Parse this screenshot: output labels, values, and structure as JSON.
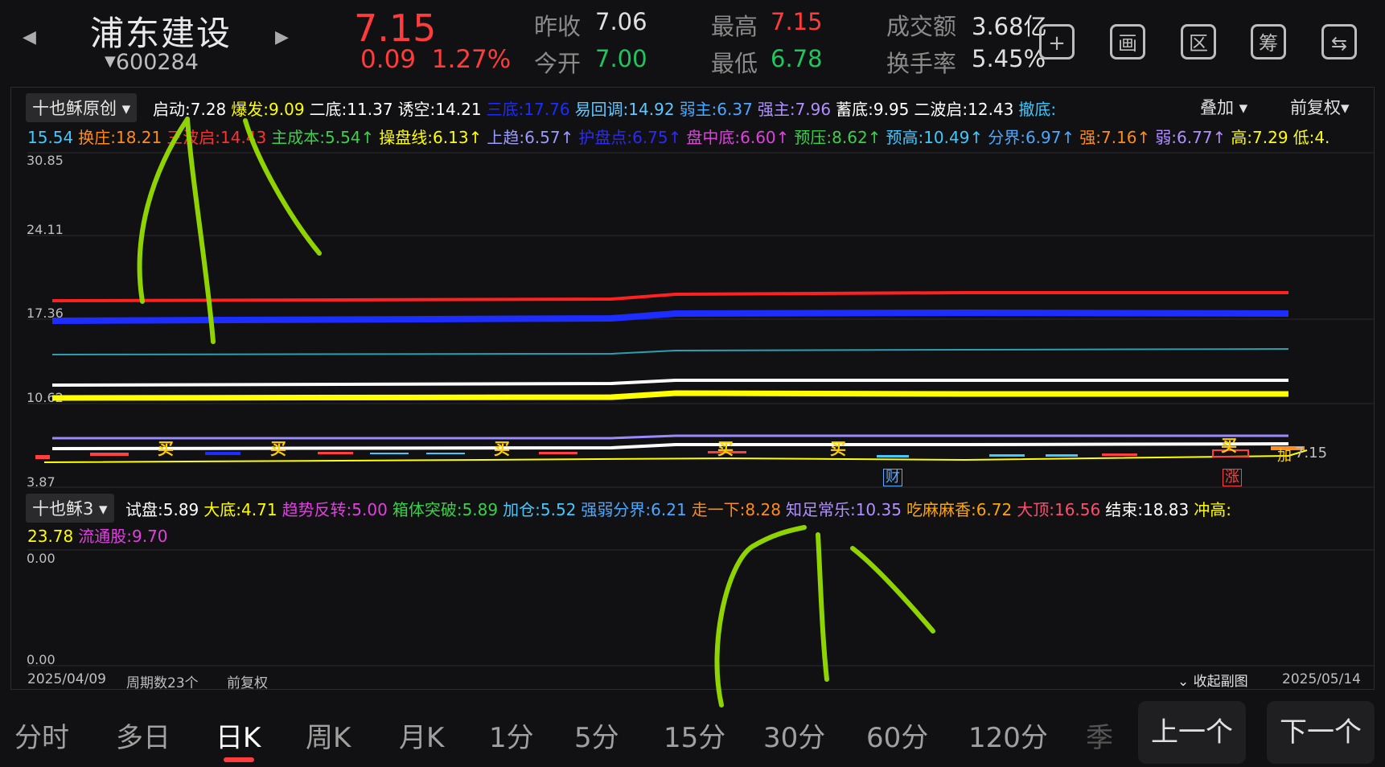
{
  "header": {
    "name": "浦东建设",
    "code": "600284",
    "price": "7.15",
    "change": "0.09",
    "change_pct": "1.27%",
    "prev_close_label": "昨收",
    "prev_close": "7.06",
    "open_label": "今开",
    "open": "7.00",
    "high_label": "最高",
    "high": "7.15",
    "low_label": "最低",
    "low": "6.78",
    "turnover_amt_label": "成交额",
    "turnover_amt": "3.68亿",
    "turnover_rate_label": "换手率",
    "turnover_rate": "5.45%"
  },
  "tools": [
    {
      "name": "add-icon",
      "glyph": "+"
    },
    {
      "name": "draw-icon",
      "glyph": "画"
    },
    {
      "name": "range-icon",
      "glyph": "区"
    },
    {
      "name": "chips-icon",
      "glyph": "筹"
    },
    {
      "name": "switch-device-icon",
      "glyph": "⇆"
    }
  ],
  "main_indicator": {
    "selector": "十也稣原创",
    "overlay": "叠加",
    "adjust": "前复权",
    "row1": [
      {
        "t": "启动:7.28",
        "c": "#ffffff"
      },
      {
        "t": "爆发:9.09",
        "c": "#ffff00"
      },
      {
        "t": "二底:11.37",
        "c": "#ffffff"
      },
      {
        "t": "诱空:14.21",
        "c": "#ffffff"
      },
      {
        "t": "三底:17.76",
        "c": "#1d2cff"
      },
      {
        "t": "易回调:14.92",
        "c": "#5fc8ff"
      },
      {
        "t": "弱主:6.37",
        "c": "#4aa8ff"
      },
      {
        "t": "强主:7.96",
        "c": "#b090ff"
      },
      {
        "t": "蓄底:9.95",
        "c": "#ffffff"
      },
      {
        "t": "二波启:12.43",
        "c": "#ffffff"
      },
      {
        "t": "撤底:",
        "c": "#40c8ff"
      }
    ],
    "row2": [
      {
        "t": "15.54",
        "c": "#40c8ff"
      },
      {
        "t": "换庄:18.21",
        "c": "#ff8c1a"
      },
      {
        "t": "三波启:14.43",
        "c": "#ff3030"
      },
      {
        "t": "主成本:5.54↑",
        "c": "#3ad04a"
      },
      {
        "t": "操盘线:6.13↑",
        "c": "#ffff00"
      },
      {
        "t": "上趋:6.57↑",
        "c": "#9a9aff"
      },
      {
        "t": "护盘点:6.75↑",
        "c": "#2a2aff"
      },
      {
        "t": "盘中底:6.60↑",
        "c": "#e040e0"
      },
      {
        "t": "预压:8.62↑",
        "c": "#3ad04a"
      },
      {
        "t": "预高:10.49↑",
        "c": "#40c8ff"
      },
      {
        "t": "分界:6.97↑",
        "c": "#4aa8ff"
      },
      {
        "t": "强:7.16↑",
        "c": "#ff8c1a"
      },
      {
        "t": "弱:6.77↑",
        "c": "#b090ff"
      },
      {
        "t": "高:7.29",
        "c": "#ffff00"
      },
      {
        "t": "低:4.",
        "c": "#ffff00"
      }
    ],
    "y_ticks": [
      "30.85",
      "24.11",
      "17.36",
      "10.62",
      "3.87"
    ],
    "markers": [
      "买",
      "买",
      "买",
      "买",
      "买",
      "买"
    ],
    "tags": {
      "cai": "财",
      "zhang": "涨",
      "jia": "加",
      "last": "7.15"
    }
  },
  "sub_indicator": {
    "selector": "十也稣3",
    "row1": [
      {
        "t": "试盘:5.89",
        "c": "#ffffff"
      },
      {
        "t": "大底:4.71",
        "c": "#ffff00"
      },
      {
        "t": "趋势反转:5.00",
        "c": "#e040e0"
      },
      {
        "t": "箱体突破:5.89",
        "c": "#3ad04a"
      },
      {
        "t": "加仓:5.52",
        "c": "#40c8ff"
      },
      {
        "t": "强弱分界:6.21",
        "c": "#4aa8ff"
      },
      {
        "t": "走一下:8.28",
        "c": "#ff8c1a"
      },
      {
        "t": "知足常乐:10.35",
        "c": "#b090ff"
      },
      {
        "t": "吃麻麻香:6.72",
        "c": "#ffa500"
      },
      {
        "t": "大顶:16.56",
        "c": "#ff4d6d"
      },
      {
        "t": "结束:18.83",
        "c": "#ffffff"
      },
      {
        "t": "冲高:",
        "c": "#ffff00"
      }
    ],
    "row2": [
      {
        "t": "23.78",
        "c": "#ffff00"
      },
      {
        "t": "流通股:9.70",
        "c": "#e040e0"
      }
    ],
    "y_ticks": [
      "0.00",
      "0.00"
    ]
  },
  "footer": {
    "start_date": "2025/04/09",
    "periods": "周期数23个",
    "adjust": "前复权",
    "collapse": "收起副图",
    "end_date": "2025/05/14"
  },
  "tabs": [
    "分时",
    "多日",
    "日K",
    "周K",
    "月K",
    "1分",
    "5分",
    "15分",
    "30分",
    "60分",
    "120分",
    "季"
  ],
  "active_tab": "日K",
  "nav": {
    "prev": "上一个",
    "next": "下一个"
  },
  "colors": {
    "up": "#ff3b3b",
    "down": "#21c55d",
    "annotation": "#8fd400"
  }
}
